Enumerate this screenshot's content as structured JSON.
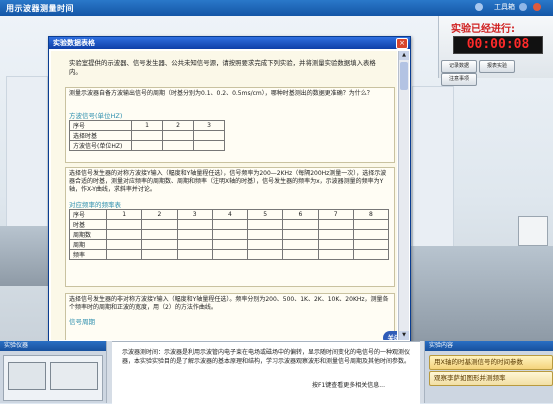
{
  "app": {
    "title": "用示波器测量时间",
    "tools_label": "工具箱"
  },
  "timer": {
    "label": "实验已经进行:",
    "time": "00:00:08",
    "buttons": [
      "记录数据",
      "报表实验",
      "注意事项"
    ]
  },
  "dialog": {
    "title": "实验数据表格",
    "intro": "实验室提供的示波器、信号发生器、公共未知信号源，请按照要求完成下列实验，并将测量实验数据填入表格内。",
    "q1": {
      "text": "测量示波器自备方波输出信号的周期（时基分别为0.1、0.2、0.5ms/cm），哪种时基测出的数据更准确？为什么？",
      "subtitle": "方波信号(单位HZ)",
      "row_labels": [
        "序号",
        "选择时基",
        "方波信号(单位HZ)"
      ],
      "cols": [
        "1",
        "2",
        "3"
      ]
    },
    "q2": {
      "text": "选择信号发生器的对称方波接Y输入（幅度和Y轴量程任选），信号频率为200—2KHz（每隔200Hz测量一次），选择示波器合适的时基，测量对应频率的周期数、周期和频率（注明X轴的时基），信号发生器的频率为x，示波器测量的频率为Y轴，作X-Y曲线，求斜率并讨论。",
      "subtitle": "对应频率的频率表",
      "row_labels": [
        "序号",
        "时基",
        "周期数",
        "周期",
        "频率"
      ],
      "cols": [
        "1",
        "2",
        "3",
        "4",
        "5",
        "6",
        "7",
        "8"
      ]
    },
    "q3": {
      "text": "选择信号发生器的非对称方波接Y输入（幅度和Y轴量程任选）。频率分别为200、500、1K、2K、10K、20KHz，测量各个频率时的周期和正波的宽度，用（2）的方法作曲线。",
      "subtitle": "信号周期"
    },
    "close_label": "关闭"
  },
  "bottom": {
    "instrument_header": "实验仪器",
    "description": "示波器测时间：示波器是利用示波管内电子束在电场或磁场中的偏转，显示随时间变化的电信号的一种观测仪器，本实验实验目的是了解示波器的基本原理和结构，学习示波器观察波形和测量信号周期及其他时间参数。",
    "hint": "按F1键查看更多相关信息...",
    "content_header": "实验内容",
    "content_items": [
      "用X轴的时基测信号的时间参数",
      "观察李萨如图形并测频率"
    ]
  }
}
